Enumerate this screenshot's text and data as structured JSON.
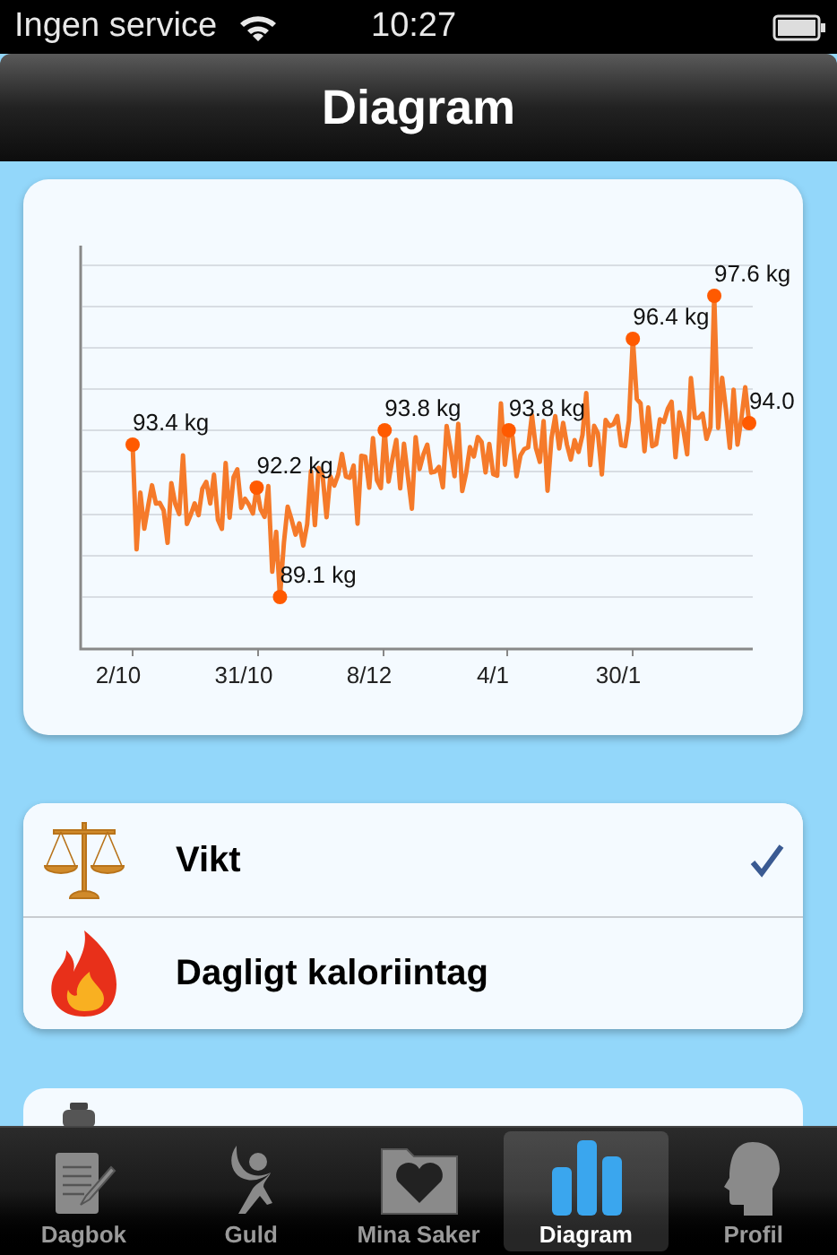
{
  "status_bar": {
    "carrier": "Ingen service",
    "time": "10:27"
  },
  "nav_bar": {
    "title": "Diagram"
  },
  "chart": {
    "point_labels": [
      "93.4 kg",
      "92.2 kg",
      "89.1 kg",
      "93.8 kg",
      "93.8 kg",
      "96.4 kg",
      "97.6 kg",
      "94.0"
    ],
    "x_labels": [
      "2/10",
      "31/10",
      "8/12",
      "4/1",
      "30/1"
    ]
  },
  "metrics": [
    {
      "label": "Vikt",
      "selected": true
    },
    {
      "label": "Dagligt kaloriintag",
      "selected": false
    }
  ],
  "tab_bar": [
    {
      "label": "Dagbok",
      "selected": false
    },
    {
      "label": "Guld",
      "selected": false
    },
    {
      "label": "Mina Saker",
      "selected": false
    },
    {
      "label": "Diagram",
      "selected": true
    },
    {
      "label": "Profil",
      "selected": false
    }
  ]
}
